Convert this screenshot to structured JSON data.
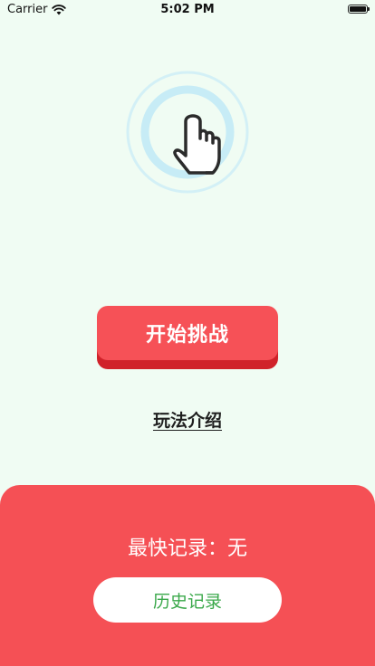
{
  "status_bar": {
    "carrier": "Carrier",
    "time": "5:02 PM"
  },
  "hero": {
    "icon": "tap-hand-icon"
  },
  "start_button": {
    "label": "开始挑战"
  },
  "rules_link": {
    "label": "玩法介绍"
  },
  "bottom_panel": {
    "best_record": "最快记录：无",
    "history_button": "历史记录"
  },
  "colors": {
    "background": "#f0fcf3",
    "accent_red": "#f65157",
    "accent_red_dark": "#d0222a",
    "history_text_green": "#3aa84a",
    "ring_blue": "#cdeff7"
  }
}
